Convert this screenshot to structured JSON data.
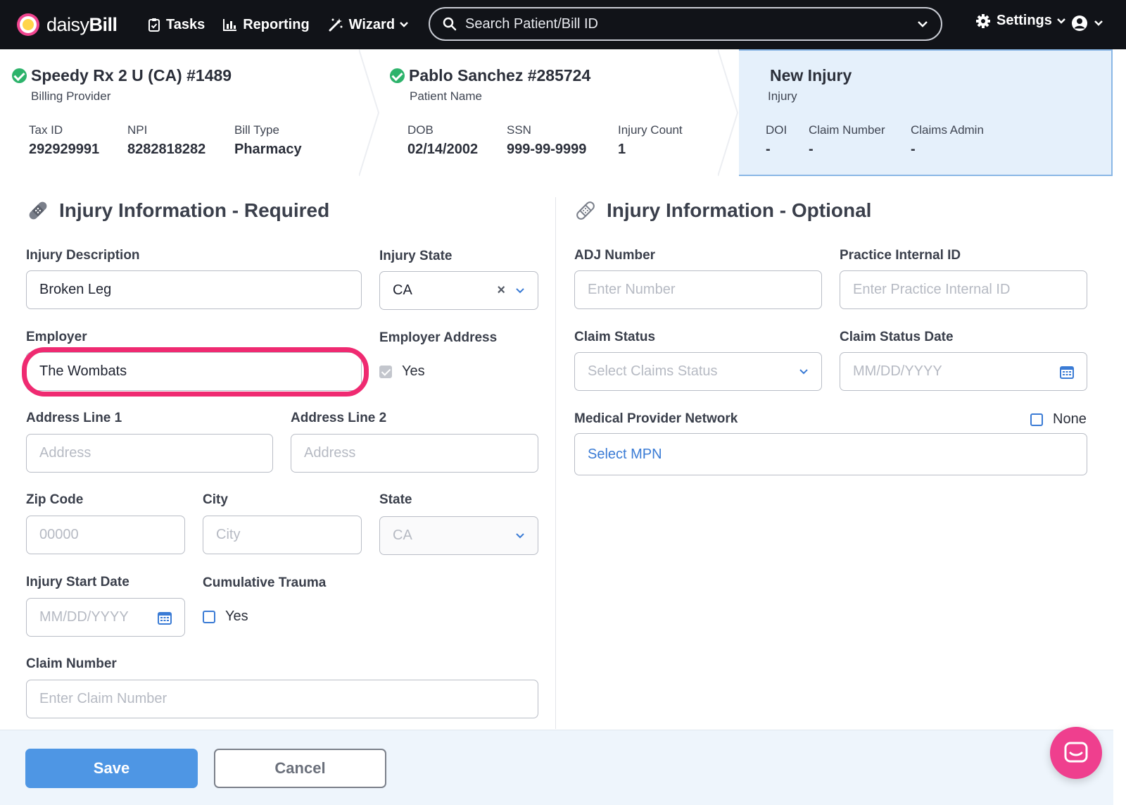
{
  "nav": {
    "brand_light": "daisy",
    "brand_bold": "Bill",
    "tasks": "Tasks",
    "reporting": "Reporting",
    "wizard": "Wizard",
    "search_placeholder": "Search Patient/Bill ID",
    "settings": "Settings"
  },
  "header": {
    "provider": {
      "title": "Speedy Rx 2 U (CA) #1489",
      "subtitle": "Billing Provider",
      "fields": [
        {
          "label": "Tax ID",
          "value": "292929991"
        },
        {
          "label": "NPI",
          "value": "8282818282"
        },
        {
          "label": "Bill Type",
          "value": "Pharmacy"
        }
      ]
    },
    "patient": {
      "title": "Pablo Sanchez #285724",
      "subtitle": "Patient Name",
      "fields": [
        {
          "label": "DOB",
          "value": "02/14/2002"
        },
        {
          "label": "SSN",
          "value": "999-99-9999"
        },
        {
          "label": "Injury Count",
          "value": "1"
        }
      ]
    },
    "injury": {
      "title": "New Injury",
      "subtitle": "Injury",
      "fields": [
        {
          "label": "DOI",
          "value": "-"
        },
        {
          "label": "Claim Number",
          "value": "-"
        },
        {
          "label": "Claims Admin",
          "value": "-"
        }
      ]
    }
  },
  "required": {
    "title": "Injury Information - Required",
    "injury_description": {
      "label": "Injury Description",
      "value": "Broken Leg"
    },
    "injury_state": {
      "label": "Injury State",
      "value": "CA"
    },
    "employer": {
      "label": "Employer",
      "value": "The Wombats"
    },
    "employer_address": {
      "label": "Employer Address",
      "option": "Yes"
    },
    "address1": {
      "label": "Address Line 1",
      "placeholder": "Address"
    },
    "address2": {
      "label": "Address Line 2",
      "placeholder": "Address"
    },
    "zip": {
      "label": "Zip Code",
      "placeholder": "00000"
    },
    "city": {
      "label": "City",
      "placeholder": "City"
    },
    "state": {
      "label": "State",
      "placeholder": "CA"
    },
    "injury_start_date": {
      "label": "Injury Start Date",
      "placeholder": "MM/DD/YYYY"
    },
    "cumulative_trauma": {
      "label": "Cumulative Trauma",
      "option": "Yes"
    },
    "claim_number": {
      "label": "Claim Number",
      "placeholder": "Enter Claim Number"
    }
  },
  "optional": {
    "title": "Injury Information - Optional",
    "adj_number": {
      "label": "ADJ Number",
      "placeholder": "Enter Number"
    },
    "practice_internal_id": {
      "label": "Practice Internal ID",
      "placeholder": "Enter Practice Internal ID"
    },
    "claim_status": {
      "label": "Claim Status",
      "placeholder": "Select Claims Status"
    },
    "claim_status_date": {
      "label": "Claim Status Date",
      "placeholder": "MM/DD/YYYY"
    },
    "mpn": {
      "label": "Medical Provider Network",
      "none_option": "None",
      "link": "Select MPN"
    }
  },
  "footer": {
    "save": "Save",
    "cancel": "Cancel"
  },
  "colors": {
    "nav_bg": "#111318",
    "accent_blue": "#4e96e4",
    "highlight_pink": "#ef2a71",
    "success_green": "#2db36b",
    "chat_pink": "#ef3f8e"
  }
}
